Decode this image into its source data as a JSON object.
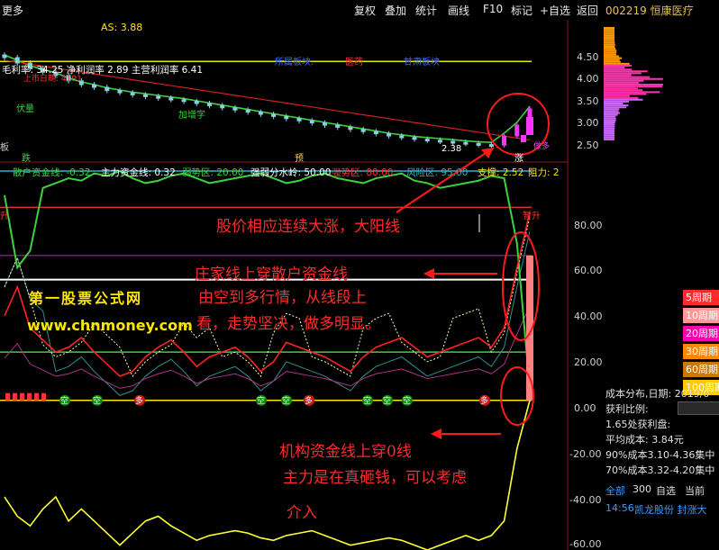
{
  "menu": [
    "复权",
    "叠加",
    "统计",
    "画线",
    "F10",
    "标记",
    "+自选",
    "返回"
  ],
  "menu_left": "更多",
  "stock": "002219 恒康医疗",
  "top_info": {
    "as": "AS: 3.88",
    "bz": "所属板块:",
    "bz2": "医药",
    "bz3": "甘肃板块",
    "profit": "毛利率: 34.25 净利润率 2.89 主营利润率 6.41",
    "lbl_red": "上市日期: 4191",
    "lbl_jiazhi": "加增字",
    "lbl_die": "跌",
    "lbl_yu": "预",
    "lbl_zhang": "涨",
    "lbl_ban": "板",
    "lbl_fuxing": "伏量",
    "lbl_duo": "做多",
    "lbl_val": "2.38"
  },
  "indicator_line": [
    {
      "text": "散户资金线: -0.32",
      "color": "#3ed13e"
    },
    {
      "text": "主力资金线: 0.32",
      "color": "#ffffff"
    },
    {
      "text": "弱势区: 20.00",
      "color": "#3ed13e"
    },
    {
      "text": "强弱分水岭: 50.00",
      "color": "#ffffff"
    },
    {
      "text": "强势区: 80.00",
      "color": "#ff3333"
    },
    {
      "text": "风险区: 95.00",
      "color": "#2fb3c8"
    },
    {
      "text": "支撑: 2.52",
      "color": "#ffe600"
    },
    {
      "text": "阻力: 2",
      "color": "#ffe600"
    }
  ],
  "upper_axis": [
    "4.50",
    "4.00",
    "3.50",
    "3.00",
    "2.50"
  ],
  "lower_axis": [
    "80.00",
    "60.00",
    "40.00",
    "20.00",
    "0.00",
    "-20.00",
    "-40.00",
    "-60.00"
  ],
  "annotations": {
    "a1": "股价相应连续大涨，大阳线",
    "a2": "庄家线上穿散户资金线",
    "a3": "由空到多行情，从线段上",
    "a4": "看，走势坚决，做多明显。",
    "a5": "机构资金线上穿0线",
    "a6": "主力是在真砸钱，可以考虑",
    "a7": "介入"
  },
  "watermark": {
    "line1": "第一股票公式网",
    "line2": "www.chnmoney.com"
  },
  "markers": [
    "空",
    "空",
    "多",
    "空",
    "空",
    "多",
    "空",
    "空",
    "空",
    "多"
  ],
  "lower_labels": {
    "left": "升",
    "right": "暂升"
  },
  "right_panel": {
    "legend": [
      "5周期",
      "10周期",
      "20周期",
      "30周期",
      "60周期",
      "100周期"
    ],
    "legend_colors": [
      "#ff2a2a",
      "#ff9999",
      "#ff00aa",
      "#ff8800",
      "#cc7700",
      "#ffcc00"
    ],
    "info": [
      "成本分布,日期:  2019/0",
      "获利比例:",
      "1.65处获利盘:",
      "平均成本: 3.84元",
      "90%成本3.10-4.36集中",
      "70%成本3.32-4.20集中"
    ],
    "tabs": [
      "全部",
      "300",
      "自选",
      "当前"
    ],
    "ticker_time": "14:56",
    "ticker_text": "凯龙股份  封涨大"
  },
  "chart_data": {
    "type": "line",
    "title": "",
    "price_axis": {
      "ylim": [
        2.2,
        4.7
      ],
      "ticks": [
        4.5,
        4.0,
        3.5,
        3.0,
        2.5
      ]
    },
    "indicator_axis": {
      "ylim": [
        -62,
        95
      ],
      "ticks": [
        80,
        60,
        40,
        20,
        0,
        -20,
        -40,
        -60
      ]
    },
    "levels": {
      "weak": 20,
      "divide": 50,
      "strong": 80,
      "risk": 95
    },
    "price_close": [
      4.05,
      3.95,
      3.85,
      3.78,
      3.72,
      3.62,
      3.55,
      3.5,
      3.44,
      3.4,
      3.36,
      3.33,
      3.3,
      3.27,
      3.24,
      3.2,
      3.16,
      3.12,
      3.08,
      3.04,
      3.0,
      2.96,
      2.92,
      2.88,
      2.84,
      2.8,
      2.76,
      2.72,
      2.68,
      2.64,
      2.6,
      2.57,
      2.54,
      2.52,
      2.5,
      2.48,
      2.46,
      2.44,
      2.43,
      2.6,
      2.8,
      3.1
    ],
    "series": [
      {
        "name": "散户资金线",
        "color": "#3ed13e",
        "values": [
          85,
          55,
          62,
          88,
          90,
          92,
          91,
          94,
          93,
          95,
          92,
          90,
          91,
          93,
          94,
          92,
          90,
          91,
          92,
          93,
          94,
          92,
          90,
          91,
          93,
          94,
          92,
          91,
          90,
          92,
          93,
          94,
          91,
          90,
          88,
          89,
          90,
          91,
          93,
          92,
          65,
          5
        ]
      },
      {
        "name": "主力资金线",
        "color": "#ff2222",
        "values": [
          35,
          47,
          30,
          25,
          20,
          22,
          26,
          20,
          15,
          10,
          12,
          18,
          22,
          25,
          20,
          14,
          18,
          20,
          22,
          18,
          12,
          16,
          24,
          22,
          20,
          18,
          15,
          12,
          18,
          22,
          24,
          26,
          22,
          18,
          20,
          22,
          24,
          26,
          22,
          30,
          55,
          78
        ]
      },
      {
        "name": "机构资金线",
        "color": "#ffff33",
        "values": [
          -40,
          -48,
          -52,
          -45,
          -40,
          -50,
          -45,
          -50,
          -55,
          -60,
          -55,
          -50,
          -48,
          -52,
          -55,
          -58,
          -56,
          -55,
          -54,
          -55,
          -57,
          -58,
          -56,
          -55,
          -54,
          -56,
          -58,
          -60,
          -59,
          -58,
          -57,
          -58,
          -60,
          -62,
          -60,
          -58,
          -56,
          -58,
          -56,
          -50,
          -20,
          0
        ]
      }
    ]
  }
}
